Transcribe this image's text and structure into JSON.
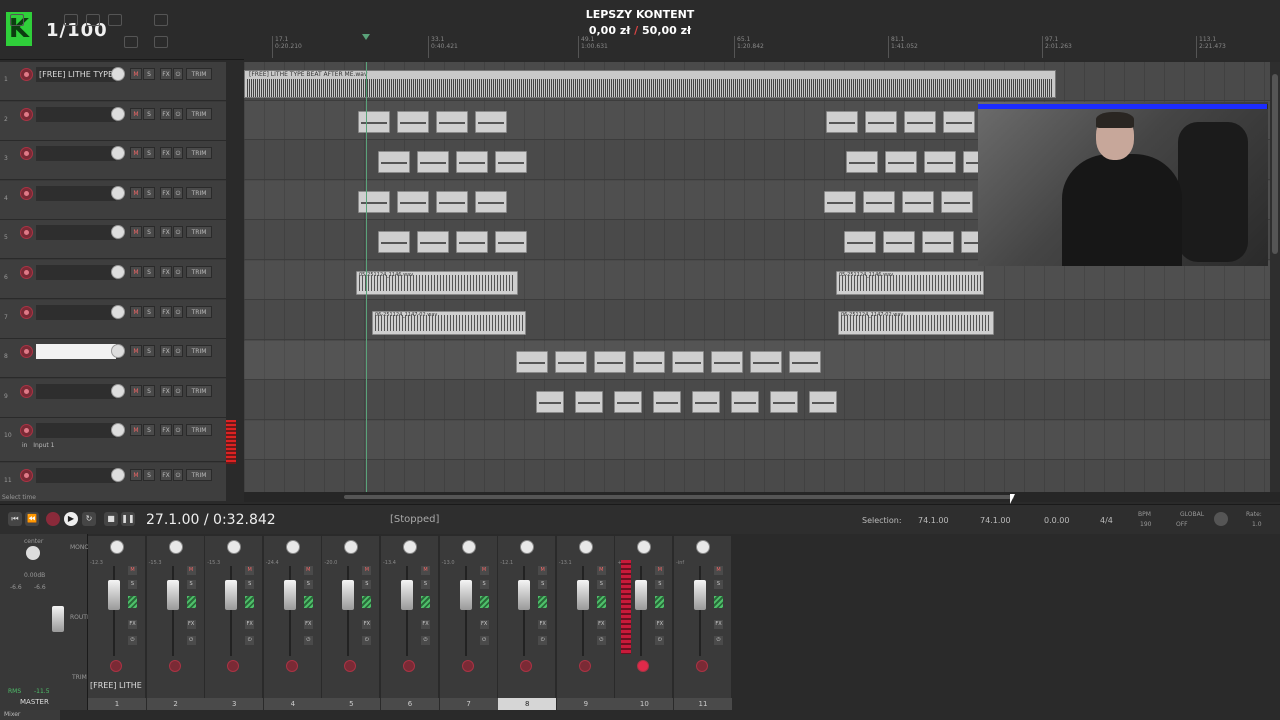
{
  "overlay": {
    "counter": "1/100",
    "donation_title": "LEPSZY KONTENT",
    "donation_current": "0,00 zł",
    "donation_sep": "/",
    "donation_goal": "50,00 zł",
    "donation_progress": 0
  },
  "ruler": {
    "ticks": [
      {
        "bar": "17.1",
        "time": "0:20.210"
      },
      {
        "bar": "33.1",
        "time": "0:40.421"
      },
      {
        "bar": "49.1",
        "time": "1:00.631"
      },
      {
        "bar": "65.1",
        "time": "1:20.842"
      },
      {
        "bar": "81.1",
        "time": "1:41.052"
      },
      {
        "bar": "97.1",
        "time": "2:01.263"
      },
      {
        "bar": "113.1",
        "time": "2:21.473"
      }
    ]
  },
  "tracks": [
    {
      "num": "1",
      "name": "[FREE] LITHE TYPE"
    },
    {
      "num": "2",
      "name": ""
    },
    {
      "num": "3",
      "name": ""
    },
    {
      "num": "4",
      "name": ""
    },
    {
      "num": "5",
      "name": ""
    },
    {
      "num": "6",
      "name": ""
    },
    {
      "num": "7",
      "name": ""
    },
    {
      "num": "8",
      "name": ""
    },
    {
      "num": "9",
      "name": ""
    },
    {
      "num": "10",
      "name": "",
      "input": "Input 1"
    },
    {
      "num": "11",
      "name": ""
    }
  ],
  "track_buttons": {
    "mute": "M",
    "solo": "S",
    "fx": "FX",
    "io": "⏻",
    "trim": "TRIM",
    "input_label": "in"
  },
  "items": {
    "beat": "[FREE] LITHE TYPE BEAT AFTER ME.wav",
    "item6a": "05-251124_1146.wav",
    "item6b": "05-251124_1146.wav",
    "item7a": "06-251124_1147-02.wav",
    "item7b": "06-251124_1147-02.wav"
  },
  "status_hint": "Select time",
  "transport": {
    "position": "27.1.00 / 0:32.842",
    "state": "[Stopped]",
    "selection_label": "Selection:",
    "selection_start": "74.1.00",
    "selection_end": "74.1.00",
    "selection_length": "0.0.00",
    "time_sig": "4/4",
    "bpm_label": "BPM",
    "bpm": "190",
    "global_label": "GLOBAL",
    "global_state": "OFF",
    "rate_label": "Rate:",
    "rate": "1.0"
  },
  "mixer": {
    "master_label": "MASTER",
    "center": "center",
    "master_db": "0.00dB",
    "master_peak_l": "-6.6",
    "master_peak_r": "-6.6",
    "rms_label": "RMS",
    "rms_value": "-11.5",
    "mono": "MONO",
    "route": "ROUTE",
    "trim": "TRIM",
    "first_track_name": "[FREE] LITHE",
    "tab": "Mixer",
    "channels": [
      {
        "num": "1",
        "db": "-12.3"
      },
      {
        "num": "2",
        "db": "-15.3"
      },
      {
        "num": "3",
        "db": "-15.3"
      },
      {
        "num": "4",
        "db": "-24.4"
      },
      {
        "num": "5",
        "db": "-20.0"
      },
      {
        "num": "6",
        "db": "-13.4"
      },
      {
        "num": "7",
        "db": "-13.0"
      },
      {
        "num": "8",
        "db": "-12.1"
      },
      {
        "num": "9",
        "db": "-13.1"
      },
      {
        "num": "10",
        "db": "+0.0"
      },
      {
        "num": "11",
        "db": "-inf"
      }
    ]
  },
  "colors": {
    "accent_green": "#2fcf3a",
    "record_red": "#e02a4a",
    "webcam_strip": "#1c2cff"
  }
}
